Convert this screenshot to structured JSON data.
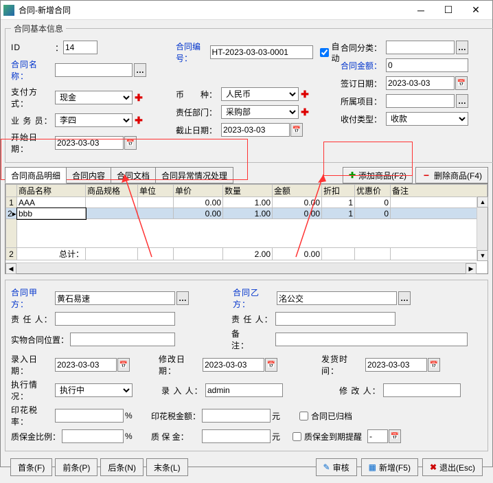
{
  "title": "合同-新增合同",
  "fs1": {
    "legend": "合同基本信息",
    "idLabel": "ID",
    "id": "14",
    "noLabel": "合同编号：",
    "no": "HT-2023-03-03-0001",
    "autoLabel": "自动",
    "auto": true,
    "catLabel": "合同分类：",
    "nameLabel": "合同名称：",
    "amtLabel": "合同金额：",
    "amt": "0",
    "payLabel": "支付方式：",
    "pay": "现金",
    "curLabel": "币　　种：",
    "cur": "人民币",
    "signLabel": "签订日期：",
    "sign": "2023-03-03",
    "bizLabel": "业 务 员：",
    "biz": "李四",
    "deptLabel": "责任部门：",
    "dept": "采购部",
    "projLabel": "所属项目：",
    "startLabel": "开始日期：",
    "start": "2023-03-03",
    "endLabel": "截止日期：",
    "end": "2023-03-03",
    "recLabel": "收付类型：",
    "rec": "收款"
  },
  "tabs": [
    "合同商品明细",
    "合同内容",
    "合同文档",
    "合同异常情况处理"
  ],
  "addBtn": "添加商品(F2)",
  "delBtn": "删除商品(F4)",
  "cols": [
    "商品名称",
    "商品规格",
    "单位",
    "单价",
    "数量",
    "金额",
    "折扣",
    "优惠价",
    "备注"
  ],
  "rows": [
    {
      "name": "AAA",
      "spec": "",
      "unit": "",
      "price": "0.00",
      "qty": "1.00",
      "amt": "0.00",
      "disc": "1",
      "promo": "0",
      "note": ""
    },
    {
      "name": "bbb",
      "spec": "",
      "unit": "",
      "price": "0.00",
      "qty": "1.00",
      "amt": "0.00",
      "disc": "1",
      "promo": "0",
      "note": ""
    }
  ],
  "total": {
    "label": "总计：",
    "count": "2",
    "qty": "2.00",
    "amt": "0.00"
  },
  "fs2": {
    "aLabel": "合同甲方：",
    "a": "黄石易速",
    "bLabel": "合同乙方：",
    "b": "洺公交",
    "apLabel": "责 任 人：",
    "bpLabel": "责 任 人：",
    "locLabel": "实物合同位置：",
    "noteLabel": "备　　注：",
    "inLabel": "录入日期：",
    "in": "2023-03-03",
    "modLabel": "修改日期：",
    "mod": "2023-03-03",
    "shipLabel": "发货时间：",
    "ship": "2023-03-03",
    "execLabel": "执行情况：",
    "exec": "执行中",
    "enterLabel": "录 入 人：",
    "enter": "admin",
    "moderLabel": "修 改 人：",
    "stampRateLabel": "印花税率：",
    "pct": "%",
    "stampAmtLabel": "印花税金额：",
    "yuan": "元",
    "archiveLabel": "合同已归档",
    "depositRateLabel": "质保金比例：",
    "depositLabel": "质 保 金：",
    "depRemindLabel": "质保金到期提醒",
    "depRemind": "-"
  },
  "foot": {
    "first": "首条(F)",
    "prev": "前条(P)",
    "next": "后条(N)",
    "last": "末条(L)",
    "audit": "审核",
    "new": "新增(F5)",
    "exit": "退出(Esc)"
  }
}
